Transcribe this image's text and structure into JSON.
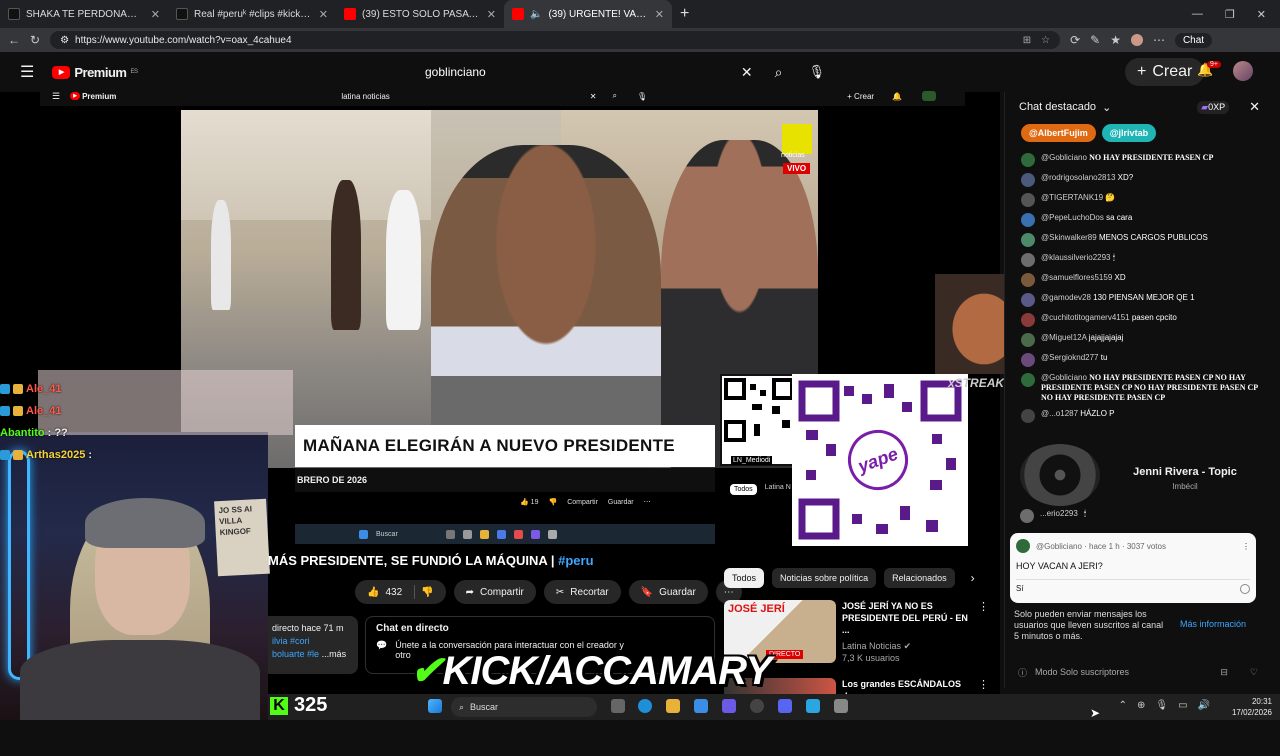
{
  "browser": {
    "tabs": [
      {
        "title": "SHAKA TE PERDONAMOS 💚 / FR",
        "color": "#1f1f1f"
      },
      {
        "title": "Real #peruᵏ #clips #kick #nanatt",
        "color": "#1f1f1f"
      },
      {
        "title": "(39) ESTO SOLO PASA EN PERU - Y",
        "color": "#ff0000"
      },
      {
        "title": "(39) URGENTE! VACARON A J",
        "color": "#ff0000"
      }
    ],
    "url": "https://www.youtube.com/watch?v=oax_4cahue4",
    "chat_button": "Chat"
  },
  "youtube": {
    "logo": "Premium",
    "logo_super": "ES",
    "search_value": "goblinciano",
    "create_label": "Crear",
    "notif_count": "9+"
  },
  "nested": {
    "logo": "Premium",
    "search_value": "latina noticias",
    "create_label": "Crear",
    "headline": "MAÑANA ELEGIRÁN A NUEVO PRESIDENTE",
    "date_text": "BRERO DE 2026",
    "noticias": "noticias",
    "vivo": "VIVO",
    "likes": "19",
    "share": "Compartir",
    "save": "Guardar",
    "filter1": "Todos",
    "filter2": "Latina N",
    "qr_label": "LN_Mediodi",
    "taskbar_search": "Buscar"
  },
  "stream_overlay": {
    "chat": [
      {
        "user": "Ale_41",
        "text": ""
      },
      {
        "user": "Ale_41",
        "text": ""
      },
      {
        "user": "Abantito",
        "text": ": ??"
      },
      {
        "user": "Arthas2025",
        "text": ":"
      }
    ],
    "sign_text": "JO SS AI VILLA KINGOF",
    "emote_label": "STREAK",
    "yape": "yape",
    "kick_text": "KICK/ACCAMARY",
    "viewers": "325",
    "colors": {
      "kick_green": "#53fc18",
      "yape_purple": "#7a1ea8"
    }
  },
  "video": {
    "title": "MÁS PRESIDENTE, SE FUNDIÓ LA MÁQUINA | ",
    "tag": "#peru",
    "likes": "432",
    "share": "Compartir",
    "clip": "Recortar",
    "save": "Guardar",
    "desc_line1": "directo hace 71 m",
    "desc_line2": "ilvia #cori",
    "desc_line3": "boluarte #le",
    "desc_more": "...más",
    "live_chat_title": "Chat en directo",
    "live_chat_text": "Únete a la conversación para interactuar con el creador y",
    "live_chat_text2": "otro"
  },
  "filters": [
    "Todos",
    "Noticias sobre política",
    "Relacionados"
  ],
  "recommendations": [
    {
      "thumb_text": "JOSÉ JERÍ",
      "thumb_badge": "DIRECTO",
      "title": "JOSÉ JERÍ YA NO ES PRESIDENTE DEL PERÚ - EN ...",
      "channel": "Latina Noticias",
      "meta": "7,3 K usuarios"
    },
    {
      "thumb_text": "",
      "thumb_badge": "",
      "title": "Los grandes ESCÁNDALOS de",
      "channel": "",
      "meta": ""
    }
  ],
  "chat_panel": {
    "title": "Chat destacado",
    "points": "0XP",
    "pins": [
      {
        "name": "@AlbertFujim",
        "color": "#e06a12"
      },
      {
        "name": "@jlrivtab",
        "color": "#1fb5b5"
      }
    ],
    "messages": [
      {
        "user": "@Gobliciano",
        "text": "NO HAY PRESIDENTE PASEN CP",
        "caps": true,
        "avatar": "#2f6b3a"
      },
      {
        "user": "@rodrigosolano2813",
        "text": "XD?",
        "caps": false,
        "avatar": "#4b5a7a"
      },
      {
        "user": "@TIGERTANK19",
        "text": "🤔",
        "caps": false,
        "avatar": "#555555"
      },
      {
        "user": "@PepeLuchoDos",
        "text": "sa cara",
        "caps": false,
        "avatar": "#3a6fb0"
      },
      {
        "user": "@Skinwalker89",
        "text": "MENOS CARGOS PUBLICOS",
        "caps": false,
        "avatar": "#4c8a6a"
      },
      {
        "user": "@klaussilverio2293",
        "text": "🕯",
        "caps": false,
        "avatar": "#6d6d6d"
      },
      {
        "user": "@samuelflores5159",
        "text": "XD",
        "caps": false,
        "avatar": "#7a5a3a"
      },
      {
        "user": "@gamodev28",
        "text": "130 PIENSAN MEJOR QE 1",
        "caps": false,
        "avatar": "#5a5a8a"
      },
      {
        "user": "@cuchitotitogamerv4151",
        "text": "pasen cpcito",
        "caps": false,
        "avatar": "#8a3a3a"
      },
      {
        "user": "@Miguel12A",
        "text": "jajajjajajaj",
        "caps": false,
        "avatar": "#4a6a4a"
      },
      {
        "user": "@Sergioknd277",
        "text": "tu",
        "caps": false,
        "avatar": "#6a4a7a"
      },
      {
        "user": "@Gobliciano",
        "text": "NO HAY PRESIDENTE PASEN CP NO HAY PRESIDENTE PASEN CP NO HAY PRESIDENTE PASEN CP NO HAY PRESIDENTE PASEN CP",
        "caps": true,
        "avatar": "#2f6b3a"
      },
      {
        "user": "@...o1287",
        "text": "HÁZLO P",
        "caps": false,
        "avatar": "#444444"
      }
    ],
    "music_title": "Jenni Rivera - Topic",
    "music_sub": "Imbécil",
    "hidden_msg_user": "...erio2293",
    "poll_author": "@Gobliciano · hace 1 h · 3037 votos",
    "poll_question": "HOY VACAN A JERI?",
    "poll_option": "Sí",
    "sub_note": "Solo pueden enviar mensajes los usuarios que lleven suscritos al canal 5 minutos o más.",
    "more_info": "Más información",
    "input_placeholder": "Modo Solo suscriptores"
  },
  "taskbar": {
    "search": "Buscar",
    "time": "20:31",
    "date": "17/02/2026"
  }
}
